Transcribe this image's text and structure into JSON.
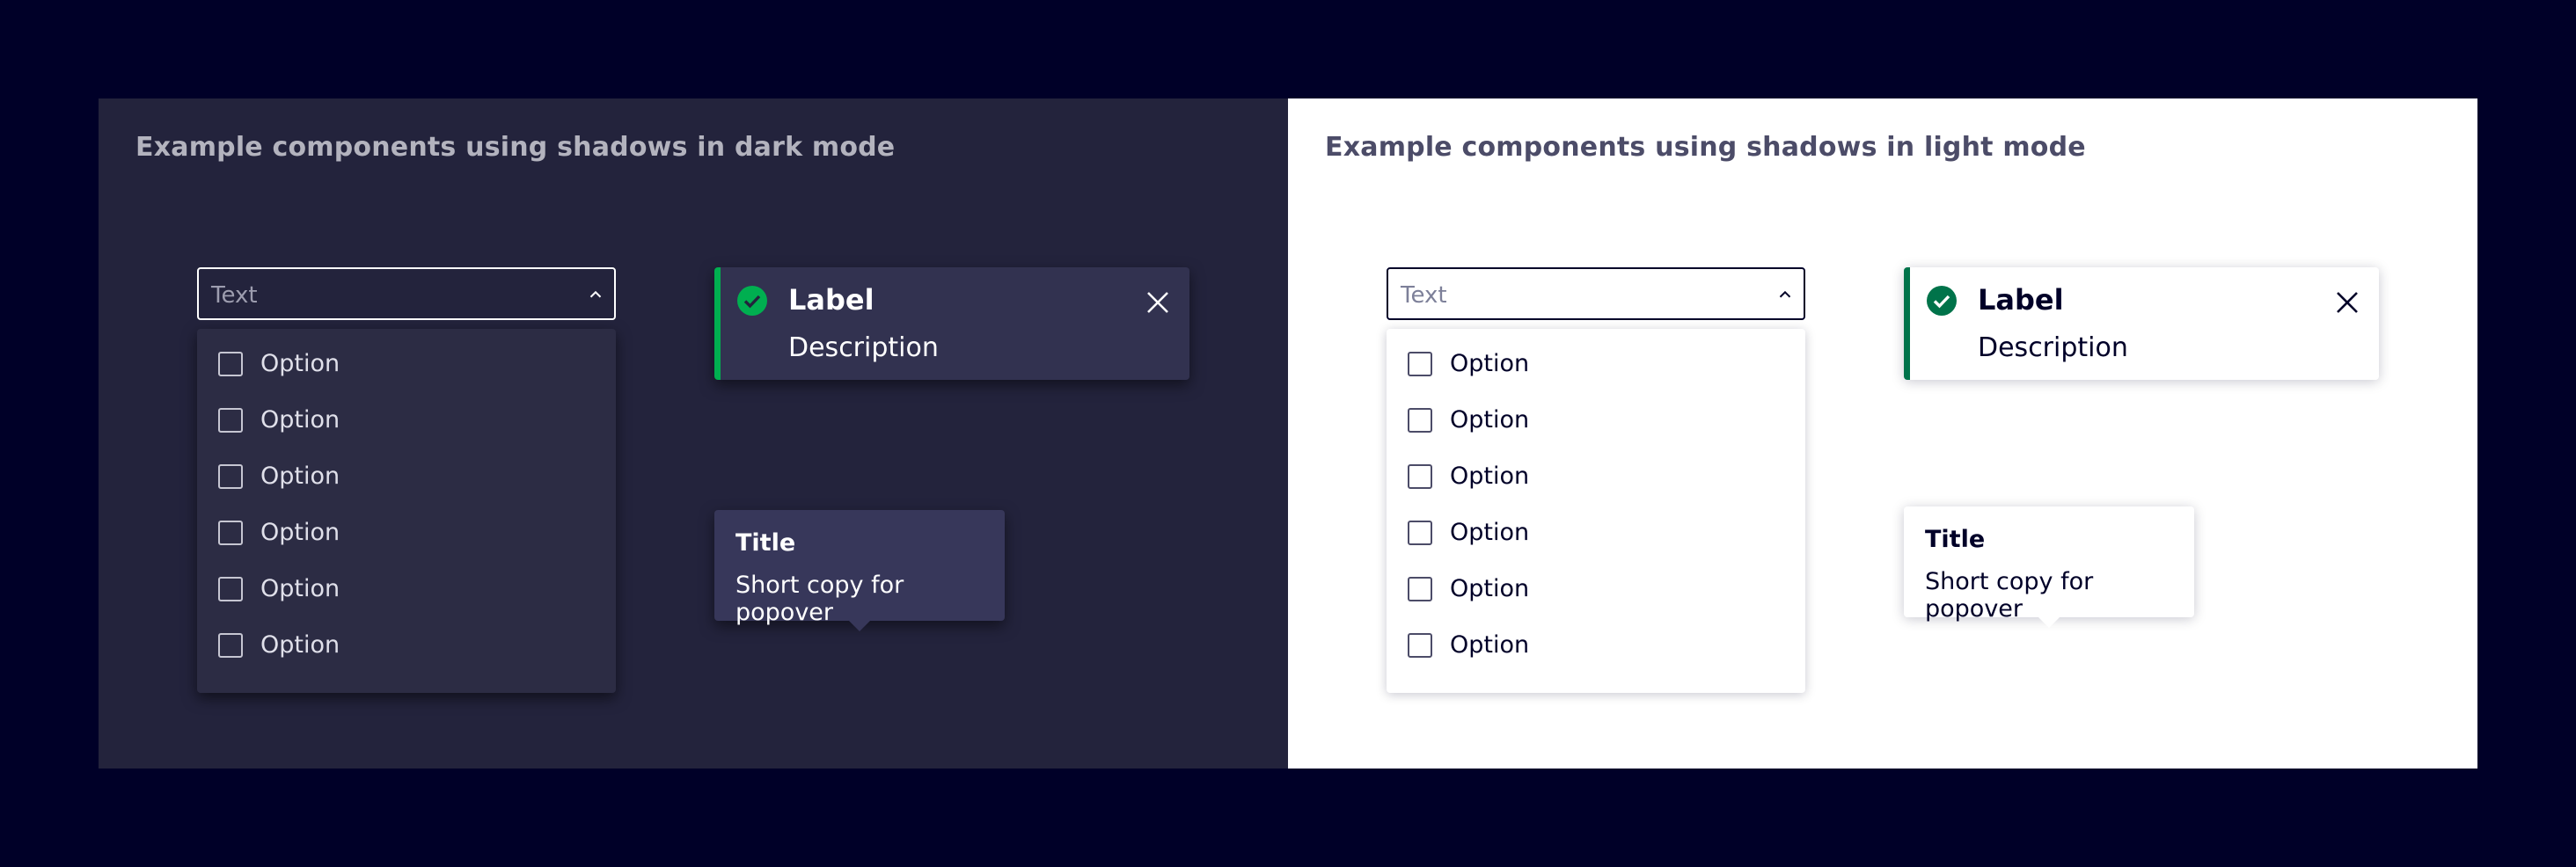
{
  "colors": {
    "page_background": "#000028",
    "dark_panel": "#23233c",
    "light_panel": "#ffffff",
    "success_dark": "#00af50",
    "success_light": "#00734a"
  },
  "dark": {
    "title": "Example components using shadows in dark mode",
    "select": {
      "value": "Text",
      "icon": "chevron-up-icon"
    },
    "options": [
      "Option",
      "Option",
      "Option",
      "Option",
      "Option",
      "Option"
    ],
    "toast": {
      "label": "Label",
      "description": "Description",
      "status_icon": "check-circle-icon",
      "close_icon": "close-icon"
    },
    "popover": {
      "title": "Title",
      "copy": "Short copy for popover"
    }
  },
  "light": {
    "title": "Example components using shadows in light mode",
    "select": {
      "value": "Text",
      "icon": "chevron-up-icon"
    },
    "options": [
      "Option",
      "Option",
      "Option",
      "Option",
      "Option",
      "Option"
    ],
    "toast": {
      "label": "Label",
      "description": "Description",
      "status_icon": "check-circle-icon",
      "close_icon": "close-icon"
    },
    "popover": {
      "title": "Title",
      "copy": "Short copy for popover"
    }
  }
}
